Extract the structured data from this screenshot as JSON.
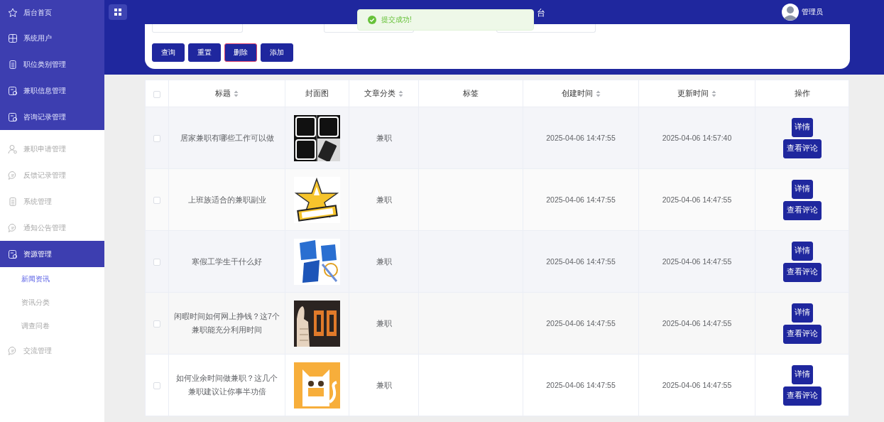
{
  "sidebar": {
    "items": [
      {
        "label": "后台首页",
        "kind": "dark",
        "selected": false
      },
      {
        "label": "系统用户",
        "kind": "dark",
        "selected": false
      },
      {
        "label": "职位类别管理",
        "kind": "dark",
        "selected": false
      },
      {
        "label": "兼职信息管理",
        "kind": "dark",
        "selected": false
      },
      {
        "label": "咨询记录管理",
        "kind": "dark",
        "selected": false
      },
      {
        "label": "兼职申请管理",
        "kind": "light",
        "selected": false
      },
      {
        "label": "反馈记录管理",
        "kind": "light",
        "selected": false
      },
      {
        "label": "系统管理",
        "kind": "light",
        "selected": false
      },
      {
        "label": "通知公告管理",
        "kind": "light",
        "selected": false
      },
      {
        "label": "资源管理",
        "kind": "light",
        "selected": true,
        "children": [
          {
            "label": "新闻资讯",
            "selected": true
          },
          {
            "label": "资讯分类",
            "selected": false
          },
          {
            "label": "调查问卷",
            "selected": false
          }
        ]
      },
      {
        "label": "交流管理",
        "kind": "light",
        "selected": false
      }
    ]
  },
  "header": {
    "title": "台",
    "user": "管理员"
  },
  "toast": {
    "message": "提交成功!"
  },
  "search": {
    "buttons": [
      {
        "label": "查询",
        "kind": "normal"
      },
      {
        "label": "重置",
        "kind": "normal"
      },
      {
        "label": "删除",
        "kind": "danger"
      },
      {
        "label": "添加",
        "kind": "normal"
      }
    ]
  },
  "table": {
    "all_checked": false,
    "columns": [
      {
        "label": "标题",
        "sortable": true
      },
      {
        "label": "封面图",
        "sortable": false
      },
      {
        "label": "文章分类",
        "sortable": true
      },
      {
        "label": "标签",
        "sortable": false
      },
      {
        "label": "创建时间",
        "sortable": true
      },
      {
        "label": "更新时间",
        "sortable": true
      },
      {
        "label": "操作",
        "sortable": false
      }
    ],
    "rows": [
      {
        "checked": false,
        "title": "居家兼职有哪些工作可以做",
        "cover": {
          "kind": "picture"
        },
        "category": "兼职",
        "created": "2025-04-06 14:47:55",
        "updated": "2025-04-06 14:57:40",
        "actions": [
          "详情",
          "查看评论"
        ]
      },
      {
        "checked": false,
        "title": "上班族适合的兼职副业",
        "cover": {
          "kind": "picture"
        },
        "category": "兼职",
        "created": "2025-04-06 14:47:55",
        "updated": "2025-04-06 14:47:55",
        "actions": [
          "详情",
          "查看评论"
        ]
      },
      {
        "checked": false,
        "title": "寒假工学生干什么好",
        "cover": {
          "kind": "picture"
        },
        "category": "兼职",
        "created": "2025-04-06 14:47:55",
        "updated": "2025-04-06 14:47:55",
        "actions": [
          "详情",
          "查看评论"
        ]
      },
      {
        "checked": false,
        "title": "闲暇时间如何网上挣钱？这7个兼职能充分利用时间",
        "cover": {
          "kind": "picture"
        },
        "category": "兼职",
        "created": "2025-04-06 14:47:55",
        "updated": "2025-04-06 14:47:55",
        "actions": [
          "详情",
          "查看评论"
        ]
      },
      {
        "checked": false,
        "title": "如何业余时间做兼职？这几个兼职建议让你事半功倍",
        "cover": {
          "kind": "picture"
        },
        "category": "兼职",
        "created": "2025-04-06 14:47:55",
        "updated": "2025-04-06 14:47:55",
        "actions": [
          "详情",
          "查看评论"
        ]
      }
    ]
  }
}
